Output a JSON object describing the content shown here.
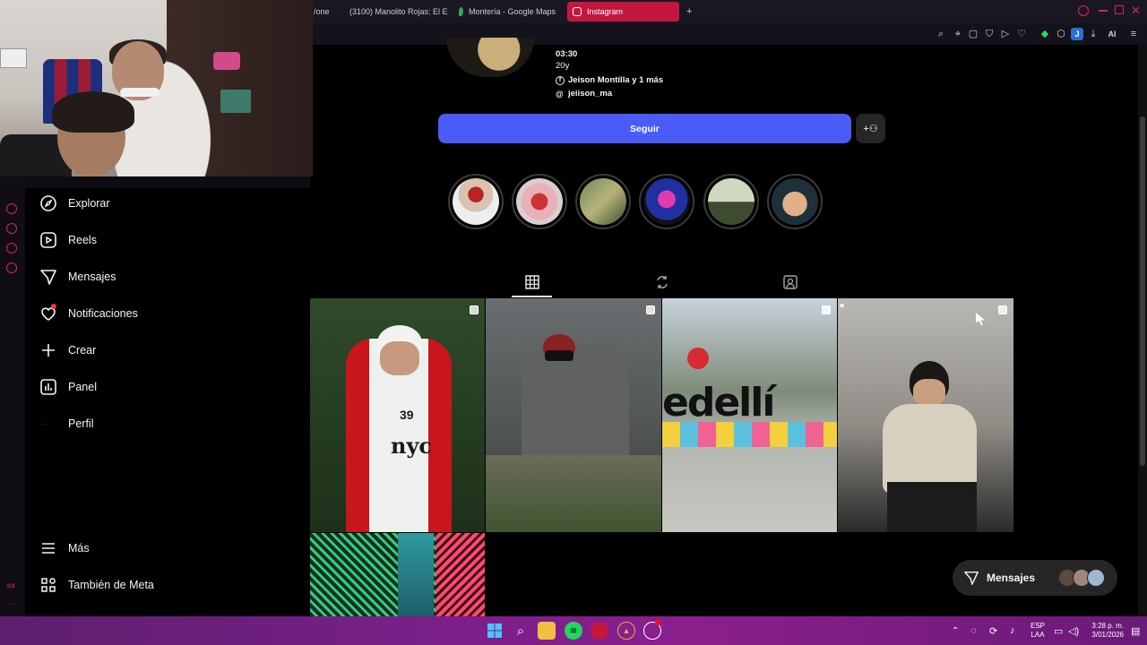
{
  "browser": {
    "tabs": [
      {
        "label": "/one",
        "active": false
      },
      {
        "label": "(3100) Manolito Rojas: El E",
        "active": false
      },
      {
        "label": "Montería - Google Maps",
        "active": false
      },
      {
        "label": "Instagram",
        "active": true
      }
    ],
    "new_tab": "+",
    "ai_label": "AI",
    "profile_initial": "J"
  },
  "profile": {
    "age_partial": "03:30",
    "age": "20y",
    "facebook_link": "Jeison Montilla y 1 más",
    "threads_handle": "jeiison_ma",
    "follow_label": "Seguir"
  },
  "nav": {
    "explore": "Explorar",
    "reels": "Reels",
    "messages": "Mensajes",
    "notifications": "Notificaciones",
    "create": "Crear",
    "dashboard": "Panel",
    "profile": "Perfil",
    "more": "Más",
    "also_meta": "También de Meta"
  },
  "post_text": {
    "jersey_number": "39",
    "sign_text": "edellí"
  },
  "messages_pill": {
    "label": "Mensajes"
  },
  "taskbar": {
    "lang_top": "ESP",
    "lang_bottom": "LAA",
    "time": "3:28 p. m.",
    "date": "3/01/2026"
  },
  "colors": {
    "accent_follow": "#4a5cf5",
    "gx_red": "#d7264f",
    "taskbar": "#7b1f8a"
  }
}
